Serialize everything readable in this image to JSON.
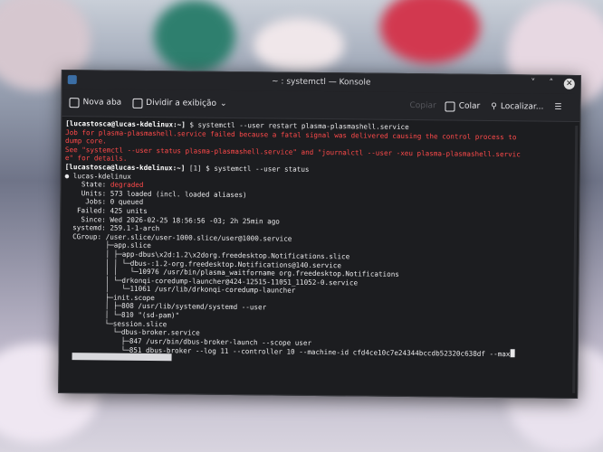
{
  "window": {
    "title": "~ : systemctl — Konsole",
    "minimize": "˅",
    "maximize": "˄",
    "close": "✕"
  },
  "toolbar": {
    "new_tab": "Nova aba",
    "split_view": "Dividir a exibição",
    "copy": "Copiar",
    "paste": "Colar",
    "find": "Localizar..."
  },
  "terminal_lines": [
    {
      "prompt": "[lucastosca@lucas-kdelinux:~]",
      "text": " $ systemctl --user restart plasma-plasmashell.service"
    },
    {
      "red": "Job for plasma-plasmashell.service failed because a fatal signal was delivered causing the control process to"
    },
    {
      "red": "dump core."
    },
    {
      "red": "See \"systemctl --user status plasma-plasmashell.service\" and \"journalctl --user -xeu plasma-plasmashell.servic"
    },
    {
      "red": "e\" for details."
    },
    {
      "prompt": "[lucastosca@lucas-kdelinux:~]",
      "text": " [1] $ systemctl --user status"
    },
    {
      "text": "● lucas-kdelinux"
    },
    {
      "text": "    State: ",
      "red2": "degraded"
    },
    {
      "text": "    Units: 573 loaded (incl. loaded aliases)"
    },
    {
      "text": "     Jobs: 0 queued"
    },
    {
      "text": "   Failed: 425 units"
    },
    {
      "text": "    Since: Wed 2026-02-25 18:56:56 -03; 2h 25min ago"
    },
    {
      "text": "  systemd: 259.1-1-arch"
    },
    {
      "text": "  CGroup: /user.slice/user-1000.slice/user@1000.service"
    },
    {
      "text": "          ├─app.slice"
    },
    {
      "text": "          │ ├─app-dbus\\x2d:1.2\\x2dorg.freedesktop.Notifications.slice"
    },
    {
      "text": "          │ │ └─dbus-:1.2-org.freedesktop.Notifications@140.service"
    },
    {
      "text": "          │ │   └─10976 /usr/bin/plasma_waitforname org.freedesktop.Notifications"
    },
    {
      "text": "          │ └─drkonqi-coredump-launcher@424-12515-11051_11052-0.service"
    },
    {
      "text": "          │   └─11061 /usr/lib/drkonqi-coredump-launcher"
    },
    {
      "text": "          ├─init.scope"
    },
    {
      "text": "          │ ├─808 /usr/lib/systemd/systemd --user"
    },
    {
      "text": "          │ └─810 \"(sd-pam)\""
    },
    {
      "text": "          └─session.slice"
    },
    {
      "text": "            └─dbus-broker.service"
    },
    {
      "text": "              ├─847 /usr/bin/dbus-broker-launch --scope user"
    },
    {
      "text": "              └─851 dbus-broker --log 11 --controller 10 --machine-id cfd4ce10c7e24344bccdb52320c638df --max"
    }
  ]
}
